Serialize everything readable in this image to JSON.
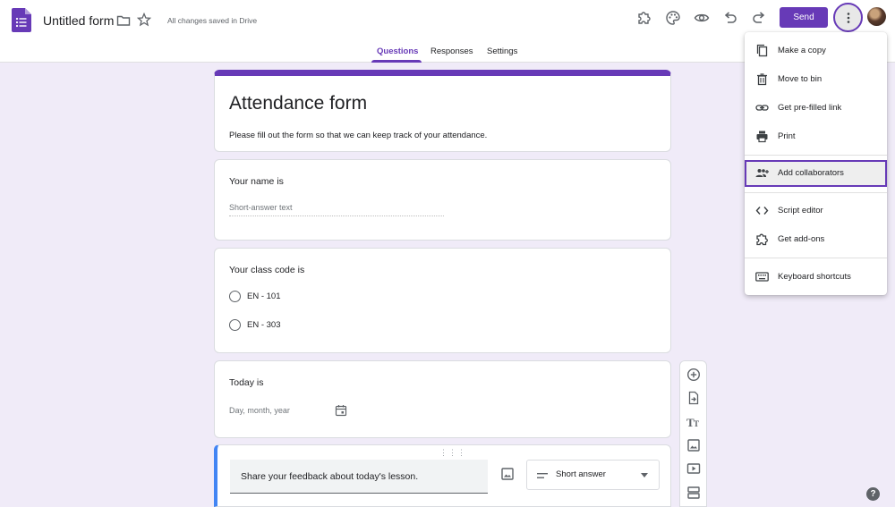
{
  "header": {
    "form_title": "Untitled form",
    "save_status": "All changes saved in Drive",
    "send_label": "Send",
    "icons": [
      "addons-icon",
      "palette-icon",
      "preview-icon",
      "undo-icon",
      "redo-icon",
      "more-vert-icon"
    ]
  },
  "tabs": [
    {
      "label": "Questions",
      "active": true
    },
    {
      "label": "Responses",
      "active": false
    },
    {
      "label": "Settings",
      "active": false
    }
  ],
  "form": {
    "heading": "Attendance form",
    "description": "Please fill out the form so that we can keep track of your attendance."
  },
  "questions": {
    "q1": {
      "title": "Your name is",
      "answer_hint": "Short-answer text"
    },
    "q2": {
      "title": "Your class code is",
      "options": [
        "EN - 101",
        "EN - 303"
      ]
    },
    "q3": {
      "title": "Today is",
      "answer_hint": "Day, month, year"
    },
    "q4": {
      "title": "Share your feedback about today's lesson.",
      "type": "Short answer"
    }
  },
  "menu": {
    "items": [
      {
        "label": "Make a copy",
        "icon": "copy-icon"
      },
      {
        "label": "Move to bin",
        "icon": "trash-icon"
      },
      {
        "label": "Get pre-filled link",
        "icon": "link-icon"
      },
      {
        "label": "Print",
        "icon": "print-icon"
      },
      {
        "label": "Add collaborators",
        "icon": "add-people-icon",
        "highlighted": true
      },
      {
        "label": "Script editor",
        "icon": "code-icon"
      },
      {
        "label": "Get add-ons",
        "icon": "addons-icon"
      },
      {
        "label": "Keyboard shortcuts",
        "icon": "keyboard-icon"
      }
    ]
  },
  "colors": {
    "accent": "#673ab7",
    "background": "#f0ebf8",
    "active_question_border": "#4285f4"
  },
  "help_label": "?"
}
